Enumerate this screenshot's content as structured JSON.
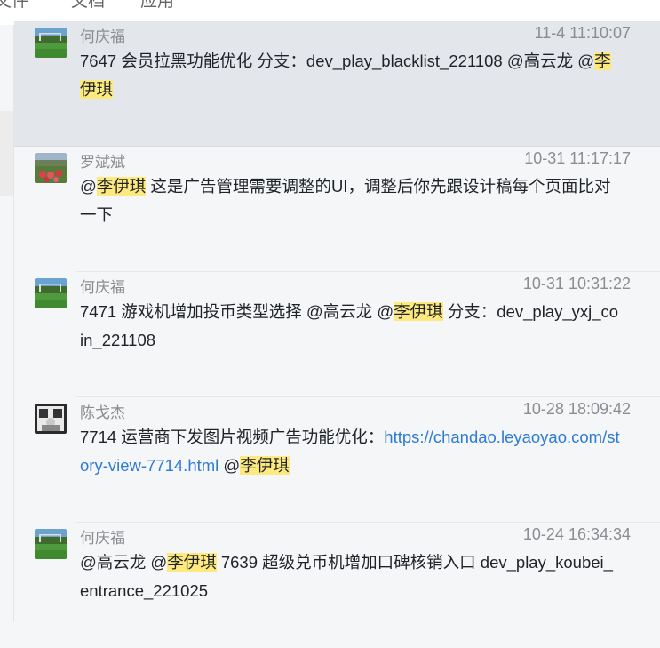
{
  "topbar": {
    "tabs": [
      "文件",
      "文档",
      "应用"
    ]
  },
  "messages": [
    {
      "sender": "何庆福",
      "time": "11-4 11:10:07",
      "parts": {
        "a": "7647 会员拉黑功能优化 分支：dev_play_blacklist_221108 @高云龙 ",
        "mention_at": "@",
        "mention": "李伊琪"
      }
    },
    {
      "sender": "罗斌斌",
      "time": "10-31 11:17:17",
      "parts": {
        "mention_at": "@",
        "mention": "李伊琪",
        "b": " 这是广告管理需要调整的UI，调整后你先跟设计稿每个页面比对一下"
      }
    },
    {
      "sender": "何庆福",
      "time": "10-31 10:31:22",
      "parts": {
        "a": "7471 游戏机增加投币类型选择 @高云龙 ",
        "mention_at": "@",
        "mention": "李伊琪",
        "b": " 分支：dev_play_yxj_coin_221108"
      }
    },
    {
      "sender": "陈戈杰",
      "time": "10-28 18:09:42",
      "parts": {
        "a": "7714 运营商下发图片视频广告功能优化：",
        "link": "https://chandao.leyaoyao.com/story-view-7714.html",
        "c": " ",
        "mention_at": "@",
        "mention": "李伊琪"
      }
    },
    {
      "sender": "何庆福",
      "time": "10-24 16:34:34",
      "parts": {
        "a": "@高云龙 ",
        "mention_at": "@",
        "mention": "李伊琪",
        "b": " 7639 超级兑币机增加口碑核销入口 dev_play_koubei_entrance_221025"
      }
    }
  ]
}
